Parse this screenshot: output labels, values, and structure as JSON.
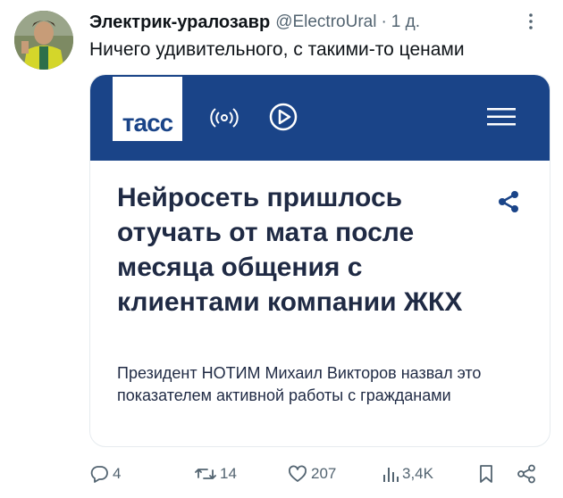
{
  "tweet": {
    "author_name": "Электрик-уралозавр",
    "handle": "@ElectroUral",
    "time": "1 д.",
    "dot": "·",
    "text": "Ничего удивительного, с такими-то ценами"
  },
  "card": {
    "logo_text": "тасс",
    "headline": "Нейросеть пришлось отучать от мата после месяца общения с клиентами компании ЖКХ",
    "lead": "Президент НОТИМ Михаил Викторов назвал это показателем активной работы с гражданами",
    "brand_color": "#1a4488"
  },
  "actions": {
    "replies": "4",
    "retweets": "14",
    "likes": "207",
    "views": "3,4K"
  },
  "icons": [
    "avatar",
    "more-icon",
    "radio-icon",
    "play-icon",
    "menu-icon",
    "share-icon",
    "reply-icon",
    "retweet-icon",
    "like-icon",
    "views-icon",
    "bookmark-icon",
    "share-tweet-icon"
  ]
}
